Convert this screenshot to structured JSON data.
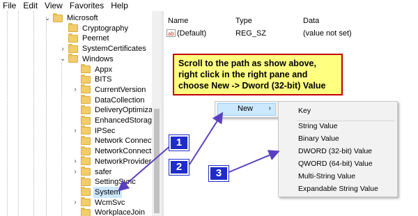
{
  "menubar": {
    "items": [
      "File",
      "Edit",
      "View",
      "Favorites",
      "Help"
    ]
  },
  "tree": {
    "items": [
      {
        "label": "Microsoft",
        "expander": "expanded",
        "selected": false
      },
      {
        "label": "Cryptography",
        "expander": "none",
        "selected": false
      },
      {
        "label": "Peernet",
        "expander": "none",
        "selected": false
      },
      {
        "label": "SystemCertificates",
        "expander": "collapsed",
        "selected": false
      },
      {
        "label": "Windows",
        "expander": "expanded",
        "selected": false
      },
      {
        "label": "Appx",
        "expander": "none",
        "selected": false
      },
      {
        "label": "BITS",
        "expander": "none",
        "selected": false
      },
      {
        "label": "CurrentVersion",
        "expander": "collapsed",
        "selected": false
      },
      {
        "label": "DataCollection",
        "expander": "none",
        "selected": false
      },
      {
        "label": "DeliveryOptimization",
        "expander": "none",
        "selected": false
      },
      {
        "label": "EnhancedStorageDev",
        "expander": "none",
        "selected": false
      },
      {
        "label": "IPSec",
        "expander": "collapsed",
        "selected": false
      },
      {
        "label": "Network Connection",
        "expander": "none",
        "selected": false
      },
      {
        "label": "NetworkConnectivity",
        "expander": "none",
        "selected": false
      },
      {
        "label": "NetworkProvider",
        "expander": "collapsed",
        "selected": false
      },
      {
        "label": "safer",
        "expander": "collapsed",
        "selected": false
      },
      {
        "label": "SettingSync",
        "expander": "none",
        "selected": false
      },
      {
        "label": "System",
        "expander": "none",
        "selected": true
      },
      {
        "label": "WcmSvc",
        "expander": "collapsed",
        "selected": false
      },
      {
        "label": "WorkplaceJoin",
        "expander": "none",
        "selected": false
      }
    ]
  },
  "values_pane": {
    "headers": {
      "name": "Name",
      "type": "Type",
      "data": "Data"
    },
    "rows": [
      {
        "icon": "string-value-icon",
        "icon_text": "ab",
        "name": "(Default)",
        "type": "REG_SZ",
        "data": "(value not set)"
      }
    ]
  },
  "callout": {
    "lines": [
      "Scroll to the path as show above,",
      "right click in the right pane and",
      "choose New -> Dword (32-bit) Value"
    ],
    "bg_color": "#ffff80",
    "border_color": "#c00000"
  },
  "context_menu": {
    "new_label": "New",
    "arrow": "›"
  },
  "submenu": {
    "items": [
      "Key",
      "String Value",
      "Binary Value",
      "DWORD (32-bit) Value",
      "QWORD (64-bit) Value",
      "Multi-String Value",
      "Expandable String Value"
    ]
  },
  "badges": [
    "1",
    "2",
    "3"
  ],
  "colors": {
    "badge": "#1f2cc9",
    "arrow": "#5a3fc0",
    "selection": "#cce8ff",
    "folder": "#f1cd6b"
  }
}
